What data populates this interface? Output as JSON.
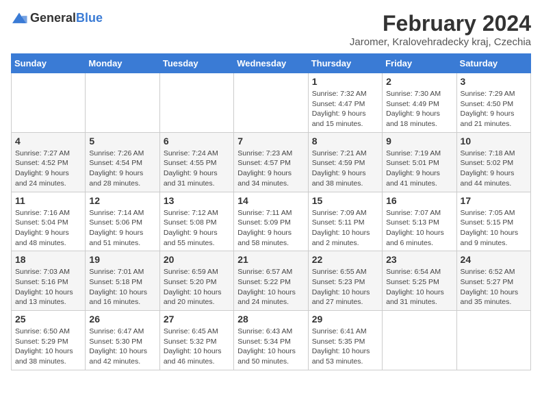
{
  "logo": {
    "general": "General",
    "blue": "Blue"
  },
  "title": "February 2024",
  "subtitle": "Jaromer, Kralovehradecky kraj, Czechia",
  "headers": [
    "Sunday",
    "Monday",
    "Tuesday",
    "Wednesday",
    "Thursday",
    "Friday",
    "Saturday"
  ],
  "weeks": [
    [
      {
        "day": "",
        "info": ""
      },
      {
        "day": "",
        "info": ""
      },
      {
        "day": "",
        "info": ""
      },
      {
        "day": "",
        "info": ""
      },
      {
        "day": "1",
        "info": "Sunrise: 7:32 AM\nSunset: 4:47 PM\nDaylight: 9 hours\nand 15 minutes."
      },
      {
        "day": "2",
        "info": "Sunrise: 7:30 AM\nSunset: 4:49 PM\nDaylight: 9 hours\nand 18 minutes."
      },
      {
        "day": "3",
        "info": "Sunrise: 7:29 AM\nSunset: 4:50 PM\nDaylight: 9 hours\nand 21 minutes."
      }
    ],
    [
      {
        "day": "4",
        "info": "Sunrise: 7:27 AM\nSunset: 4:52 PM\nDaylight: 9 hours\nand 24 minutes."
      },
      {
        "day": "5",
        "info": "Sunrise: 7:26 AM\nSunset: 4:54 PM\nDaylight: 9 hours\nand 28 minutes."
      },
      {
        "day": "6",
        "info": "Sunrise: 7:24 AM\nSunset: 4:55 PM\nDaylight: 9 hours\nand 31 minutes."
      },
      {
        "day": "7",
        "info": "Sunrise: 7:23 AM\nSunset: 4:57 PM\nDaylight: 9 hours\nand 34 minutes."
      },
      {
        "day": "8",
        "info": "Sunrise: 7:21 AM\nSunset: 4:59 PM\nDaylight: 9 hours\nand 38 minutes."
      },
      {
        "day": "9",
        "info": "Sunrise: 7:19 AM\nSunset: 5:01 PM\nDaylight: 9 hours\nand 41 minutes."
      },
      {
        "day": "10",
        "info": "Sunrise: 7:18 AM\nSunset: 5:02 PM\nDaylight: 9 hours\nand 44 minutes."
      }
    ],
    [
      {
        "day": "11",
        "info": "Sunrise: 7:16 AM\nSunset: 5:04 PM\nDaylight: 9 hours\nand 48 minutes."
      },
      {
        "day": "12",
        "info": "Sunrise: 7:14 AM\nSunset: 5:06 PM\nDaylight: 9 hours\nand 51 minutes."
      },
      {
        "day": "13",
        "info": "Sunrise: 7:12 AM\nSunset: 5:08 PM\nDaylight: 9 hours\nand 55 minutes."
      },
      {
        "day": "14",
        "info": "Sunrise: 7:11 AM\nSunset: 5:09 PM\nDaylight: 9 hours\nand 58 minutes."
      },
      {
        "day": "15",
        "info": "Sunrise: 7:09 AM\nSunset: 5:11 PM\nDaylight: 10 hours\nand 2 minutes."
      },
      {
        "day": "16",
        "info": "Sunrise: 7:07 AM\nSunset: 5:13 PM\nDaylight: 10 hours\nand 6 minutes."
      },
      {
        "day": "17",
        "info": "Sunrise: 7:05 AM\nSunset: 5:15 PM\nDaylight: 10 hours\nand 9 minutes."
      }
    ],
    [
      {
        "day": "18",
        "info": "Sunrise: 7:03 AM\nSunset: 5:16 PM\nDaylight: 10 hours\nand 13 minutes."
      },
      {
        "day": "19",
        "info": "Sunrise: 7:01 AM\nSunset: 5:18 PM\nDaylight: 10 hours\nand 16 minutes."
      },
      {
        "day": "20",
        "info": "Sunrise: 6:59 AM\nSunset: 5:20 PM\nDaylight: 10 hours\nand 20 minutes."
      },
      {
        "day": "21",
        "info": "Sunrise: 6:57 AM\nSunset: 5:22 PM\nDaylight: 10 hours\nand 24 minutes."
      },
      {
        "day": "22",
        "info": "Sunrise: 6:55 AM\nSunset: 5:23 PM\nDaylight: 10 hours\nand 27 minutes."
      },
      {
        "day": "23",
        "info": "Sunrise: 6:54 AM\nSunset: 5:25 PM\nDaylight: 10 hours\nand 31 minutes."
      },
      {
        "day": "24",
        "info": "Sunrise: 6:52 AM\nSunset: 5:27 PM\nDaylight: 10 hours\nand 35 minutes."
      }
    ],
    [
      {
        "day": "25",
        "info": "Sunrise: 6:50 AM\nSunset: 5:29 PM\nDaylight: 10 hours\nand 38 minutes."
      },
      {
        "day": "26",
        "info": "Sunrise: 6:47 AM\nSunset: 5:30 PM\nDaylight: 10 hours\nand 42 minutes."
      },
      {
        "day": "27",
        "info": "Sunrise: 6:45 AM\nSunset: 5:32 PM\nDaylight: 10 hours\nand 46 minutes."
      },
      {
        "day": "28",
        "info": "Sunrise: 6:43 AM\nSunset: 5:34 PM\nDaylight: 10 hours\nand 50 minutes."
      },
      {
        "day": "29",
        "info": "Sunrise: 6:41 AM\nSunset: 5:35 PM\nDaylight: 10 hours\nand 53 minutes."
      },
      {
        "day": "",
        "info": ""
      },
      {
        "day": "",
        "info": ""
      }
    ]
  ]
}
